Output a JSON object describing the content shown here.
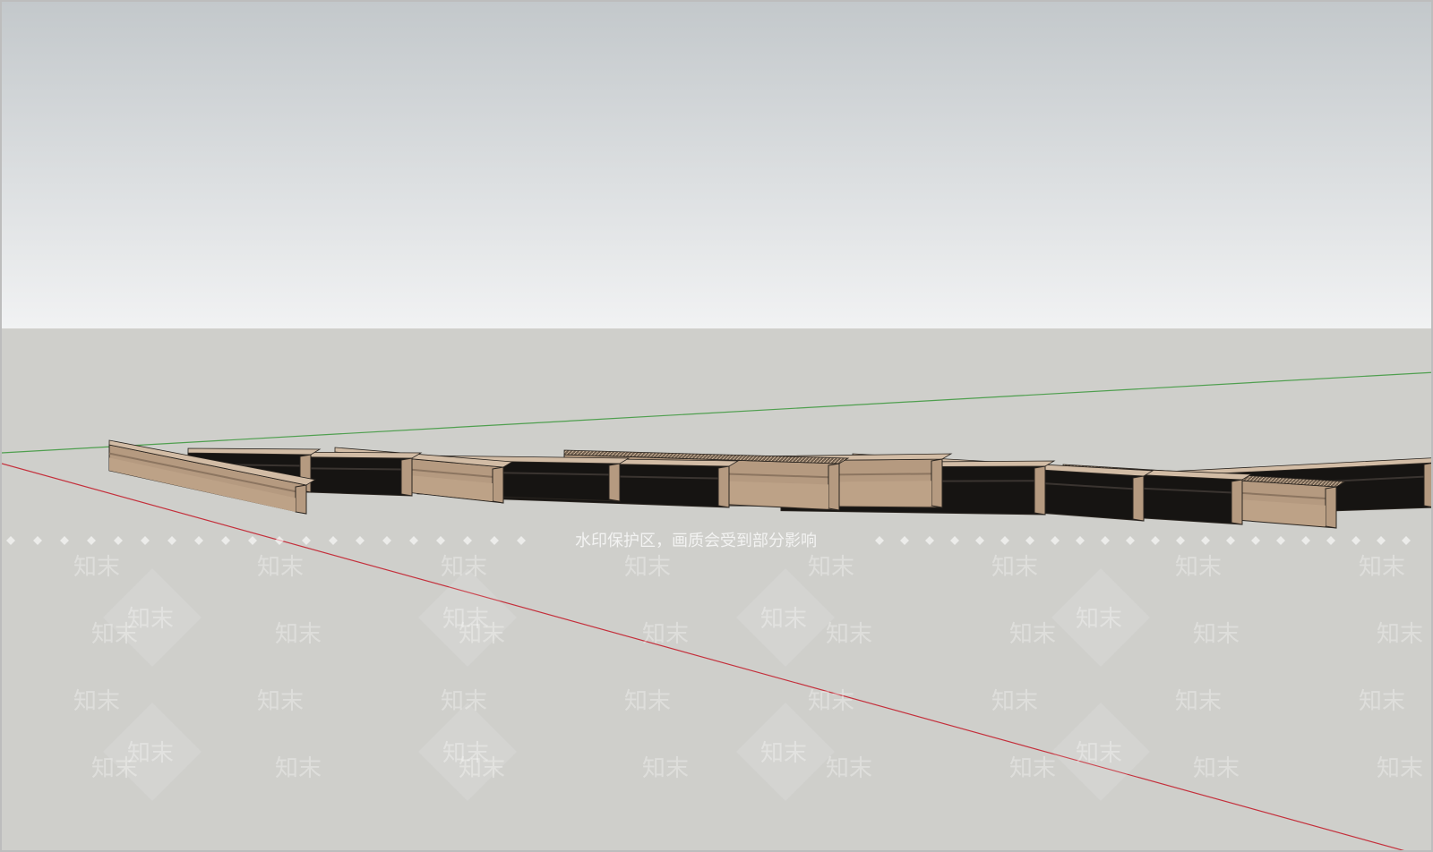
{
  "viewport": {
    "sky_top_color": "#c3c8cb",
    "sky_bottom_color": "#f1f2f3",
    "ground_color": "#cfcfcb",
    "axis_green_color": "#4f9f4f",
    "axis_red_color": "#c4303c",
    "trim_face_color": "#b59a80",
    "trim_top_color": "#d2bca5",
    "trim_dark_color": "#161412"
  },
  "models": {
    "count": 13
  },
  "watermark": {
    "brand_text": "知末",
    "notice_text": "水印保护区，画质会受到部分影响"
  }
}
